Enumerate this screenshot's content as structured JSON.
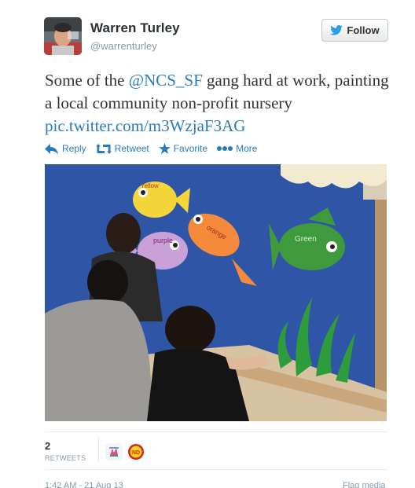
{
  "user": {
    "name": "Warren Turley",
    "handle": "@warrenturley"
  },
  "follow_button": {
    "label": "Follow",
    "icon": "twitter-bird-icon"
  },
  "tweet": {
    "text_before": "Some of the ",
    "mention": "@NCS_SF",
    "text_middle": " gang hard at work, painting a local community non-profit nursery ",
    "link": "pic.twitter.com/m3WzjaF3AG"
  },
  "actions": [
    {
      "label": "Reply",
      "icon": "reply-arrow-icon"
    },
    {
      "label": "Retweet",
      "icon": "retweet-icon"
    },
    {
      "label": "Favorite",
      "icon": "star-icon"
    },
    {
      "label": "More",
      "icon": "more-dots-icon"
    }
  ],
  "photo": {
    "fish_labels": [
      "Yellow",
      "purple",
      "orange",
      "Green"
    ]
  },
  "stats": {
    "retweet_count": "2",
    "retweet_label": "RETWEETS"
  },
  "footer": {
    "timestamp": "1:42 AM - 21 Aug 13",
    "flag_label": "Flag media"
  },
  "colors": {
    "link": "#2b7bb9",
    "wall_blue": "#2f56a6"
  }
}
